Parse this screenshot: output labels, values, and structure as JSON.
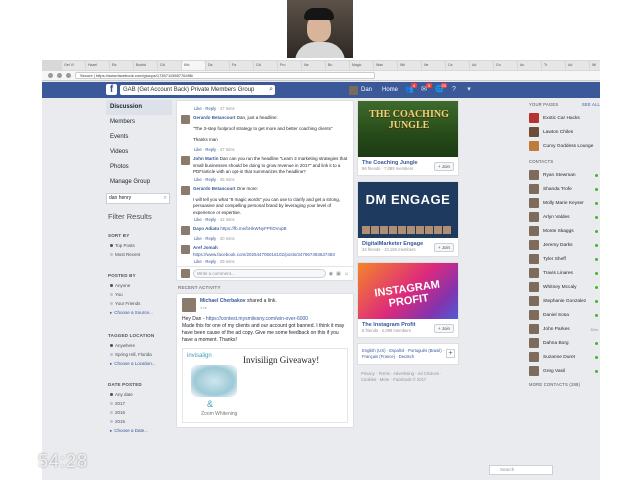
{
  "browser": {
    "tabs": [
      "Get Vi",
      "Hazel",
      "Ra",
      "Bootst",
      "GA",
      "Mic",
      "Da",
      "Fa",
      "GA",
      "Pro",
      "Na",
      "Bu",
      "Magic",
      "Wan",
      "Wh",
      "Ne",
      "Ca",
      "Ad",
      "Go",
      "An",
      "Tr",
      "Ad",
      "Wi",
      "Co",
      "Ad",
      "Ca",
      "Cat",
      "Bi",
      "Wel",
      "Ve",
      "Add",
      "Ca",
      "Ma"
    ],
    "address": "Secure | https://www.facebook.com/groups/1735711585776496/"
  },
  "fb": {
    "logo": "f",
    "search_value": "GAB (Get Account Back) Private Members Group",
    "user_name": "Dan",
    "home_label": "Home",
    "badges": {
      "friends": "4",
      "messages": "9",
      "notifications": "20"
    }
  },
  "leftnav": {
    "items": [
      "Discussion",
      "Members",
      "Events",
      "Videos",
      "Photos",
      "Manage Group"
    ],
    "search_value": "dan henry",
    "filter_title": "Filter Results",
    "sort_by": {
      "title": "SORT BY",
      "options": [
        "Top Posts",
        "Most Recent"
      ]
    },
    "posted_by": {
      "title": "POSTED BY",
      "options": [
        "Anyone",
        "You",
        "Your Friends",
        "Choose a Source..."
      ]
    },
    "tagged_location": {
      "title": "TAGGED LOCATION",
      "options": [
        "Anywhere",
        "Spring Hill, Florida",
        "Choose a Location..."
      ]
    },
    "date_posted": {
      "title": "DATE POSTED",
      "options": [
        "Any date",
        "2017",
        "2016",
        "2015",
        "Choose a Date..."
      ]
    }
  },
  "center": {
    "comments": [
      {
        "name": "",
        "text": "",
        "meta": [
          "Like",
          "Reply",
          "47 mins"
        ]
      },
      {
        "name": "Gerardo Betancourt",
        "text": "Dan, just a headline:",
        "meta": []
      },
      {
        "name": "",
        "text": "\"The 3-step foolproof strategy to get more and better coaching clients\"",
        "meta": []
      },
      {
        "name": "",
        "text": "Thanks man",
        "meta": [
          "Like",
          "Reply",
          "47 mins"
        ]
      },
      {
        "name": "John Martin",
        "text": "Dan can you run the headline \"Learn 3 marketing strategies that small businesses should be doing to grow revenue in 2017\" and link it to a PDF/article with an opt-in that summarizes the headline?",
        "meta": [
          "Like",
          "Reply",
          "45 mins"
        ]
      },
      {
        "name": "Gerardo Betancourt",
        "text": "One more:",
        "meta": []
      },
      {
        "name": "",
        "text": "I will tell you what \"8 magic words\" you can use to clarify and get a strong, persuasive and compelling personal brand by leveraging your level of experience or expertise.",
        "meta": [
          "Like",
          "Reply",
          "42 mins"
        ]
      },
      {
        "name": "Dayo Adiatu",
        "text": "https://fb.me/bHkWNyFPhDVupB",
        "meta": [
          "Like",
          "Reply",
          "40 mins"
        ]
      },
      {
        "name": "Aref Jomah",
        "text": "https://www.facebook.com/202544705016102/posts/347667493637493",
        "meta": [
          "Like",
          "Reply",
          "29 mins"
        ]
      }
    ],
    "comment_placeholder": "Write a comment...",
    "recent_activity": "RECENT ACTIVITY",
    "post": {
      "author": "Michael Cherbakov",
      "action": "shared a link.",
      "time": "1 hr",
      "text_before": "Hey Dan - ",
      "link": "https://contest.mysmilesny.com/win-over-6000",
      "text_after": "Made this for one of my clients and our account got banned. I think it may have been cause of the ad copy. Give me some feedback on this if you have a moment. Thanks!",
      "preview_logo": "invisalign",
      "preview_title": "Invisilign Giveaway!",
      "preview_amp": "&",
      "preview_zoom": "Zoom Whitening"
    }
  },
  "groups": [
    {
      "image_text": "THE COACHING JUNGLE",
      "name": "The Coaching Jungle",
      "sub": "66 friends · 7,089 members",
      "join": "+ Join"
    },
    {
      "image_text": "DM ENGAGE",
      "name": "DigitalMarketer Engage",
      "sub": "34 friends · 10,160 members",
      "join": "+ Join"
    },
    {
      "image_text": "INSTAGRAM PROFIT",
      "name": "The Instagram Profit",
      "sub": "8 friends · 2,099 members",
      "join": "+ Join"
    }
  ],
  "languages": {
    "text": "English (US) · Español · Português (Brasil) · Français (France) · Deutsch",
    "plus": "+"
  },
  "legal": "Privacy · Terms · Advertising · Ad Choices · Cookies · More · Facebook © 2017",
  "right": {
    "pages_title": "YOUR PAGES",
    "see_all": "SEE ALL",
    "pages": [
      "Exotic Car Hacks",
      "Lawton Chiles",
      "Curvy Goddess Lounge"
    ],
    "contacts_title": "CONTACTS",
    "contacts": [
      "Ryan Stewman",
      "Shanda Trofe",
      "Molly Marie Keyser",
      "Arlyn Valdes",
      "Monte Skaggs",
      "Jeremy Darks",
      "Tyler Sheff",
      "Travis Linares",
      "Whitney Mccaly",
      "Stephanie Gonzalez",
      "Daniel Sosa",
      "John Parkes",
      "Dahna Borg",
      "Suzanne Duret",
      "Greg Vasil"
    ],
    "contacts_extra": [
      "",
      "",
      "",
      "",
      "",
      "",
      "",
      "",
      "",
      "",
      "",
      "30m",
      "",
      "",
      ""
    ],
    "more_contacts": "MORE CONTACTS (288)",
    "search_placeholder": "Search"
  },
  "timer": "54:28"
}
